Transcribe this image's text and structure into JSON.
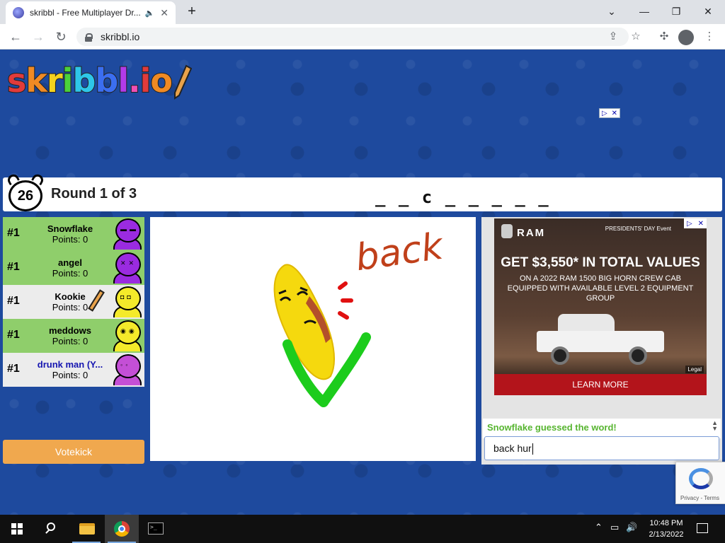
{
  "browser": {
    "tab_title": "skribbl - Free Multiplayer Dr...",
    "new_tab": "+",
    "url": "skribbl.io",
    "window_controls": {
      "minimize": "—",
      "restore": "❐",
      "close": "✕",
      "tab_search": "⌄"
    }
  },
  "logo": {
    "letters": [
      "s",
      "k",
      "r",
      "i",
      "b",
      "b",
      "l",
      ".",
      "i",
      "o"
    ]
  },
  "game": {
    "timer": "26",
    "round": "Round 1 of 3",
    "word_hint": "_ _ c _   _ _ _ _",
    "players": [
      {
        "rank": "#1",
        "name": "Snowflake",
        "points": "Points: 0",
        "color": "#9a2be0"
      },
      {
        "rank": "#1",
        "name": "angel",
        "points": "Points: 0",
        "color": "#9a2be0"
      },
      {
        "rank": "#1",
        "name": "Kookie",
        "points": "Points: 0",
        "color": "#f4ea2a"
      },
      {
        "rank": "#1",
        "name": "meddows",
        "points": "Points: 0",
        "color": "#f4ea2a"
      },
      {
        "rank": "#1",
        "name": "drunk man (Y...",
        "points": "Points: 0",
        "color": "#c44fd6"
      }
    ],
    "votekick": "Votekick",
    "canvas_word": "back"
  },
  "ad": {
    "brand": "RAM",
    "event": "PRESIDENTS' DAY Event",
    "headline": "GET $3,550* IN TOTAL VALUES",
    "sub": "ON A 2022 RAM 1500 BIG HORN CREW CAB EQUIPPED WITH AVAILABLE LEVEL 2 EQUIPMENT GROUP",
    "legal": "Legal",
    "cta": "LEARN MORE"
  },
  "chat": {
    "message": "Snowflake guessed the word!",
    "input_value": "back hur"
  },
  "recaptcha": {
    "links": "Privacy - Terms"
  },
  "taskbar": {
    "time": "10:48 PM",
    "date": "2/13/2022"
  },
  "colors": {
    "page_bg": "#1e4a9e",
    "player_green": "#8fce6b",
    "player_white": "#ececec",
    "votekick": "#f0a84e",
    "chat_green": "#57b530"
  }
}
